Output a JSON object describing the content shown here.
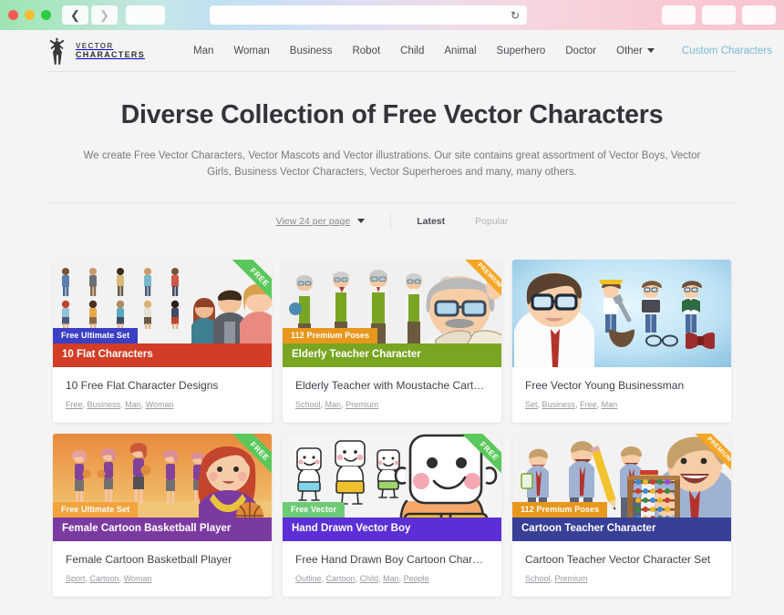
{
  "browser": {
    "back_icon": "chevron-left-icon",
    "forward_icon": "chevron-right-icon",
    "reload_icon": "reload-icon",
    "url_value": "",
    "url_placeholder": ""
  },
  "header": {
    "logo_line1": "VECTOR",
    "logo_line2": "CHARACTERS",
    "nav": [
      {
        "label": "Man"
      },
      {
        "label": "Woman"
      },
      {
        "label": "Business"
      },
      {
        "label": "Robot"
      },
      {
        "label": "Child"
      },
      {
        "label": "Animal"
      },
      {
        "label": "Superhero"
      },
      {
        "label": "Doctor"
      },
      {
        "label": "Other",
        "caret": true
      }
    ],
    "custom_link": "Custom Characters",
    "custom_link_color": "#79b9d4",
    "search_icon": "search-icon"
  },
  "hero": {
    "title": "Diverse Collection of Free Vector Characters",
    "description": "We create Free Vector Characters, Vector Mascots and Vector illustrations. Our site contains great assortment of Vector Boys, Vector Girls, Business Vector Characters, Vector Superheroes and many, many others."
  },
  "filters": {
    "per_page_label": "View 24 per page",
    "sort_latest": "Latest",
    "sort_popular": "Popular",
    "active_sort": "Latest"
  },
  "cards": [
    {
      "ribbon": "FREE",
      "ribbon_type": "free",
      "badge": "Free Ultimate Set",
      "badge_color": "#3b3fc4",
      "bar": "10 Flat Characters",
      "bar_color": "#d13d26",
      "title": "10 Free Flat Character Designs",
      "tags": [
        "Free",
        "Business",
        "Man",
        "Woman"
      ]
    },
    {
      "ribbon": "PREMIUM",
      "ribbon_type": "premium",
      "badge": "112 Premium Poses",
      "badge_color": "#e8971d",
      "bar": "Elderly Teacher Character",
      "bar_color": "#7aa522",
      "title": "Elderly Teacher with Moustache Carto…",
      "tags": [
        "School",
        "Man",
        "Premium"
      ]
    },
    {
      "ribbon": "",
      "ribbon_type": "none",
      "badge": "",
      "badge_color": "",
      "bar": "",
      "bar_color": "",
      "title": "Free Vector Young Businessman",
      "tags": [
        "Set",
        "Business",
        "Free",
        "Man"
      ]
    },
    {
      "ribbon": "FREE",
      "ribbon_type": "free",
      "badge": "Free Ultimate Set",
      "badge_color": "#f2a33c",
      "bar": "Female Cartoon Basketball Player",
      "bar_color": "#7b3aa0",
      "title": "Female Cartoon Basketball Player",
      "tags": [
        "Sport",
        "Cartoon",
        "Woman"
      ]
    },
    {
      "ribbon": "FREE",
      "ribbon_type": "free",
      "badge": "Free Vector",
      "badge_color": "#6ecb75",
      "bar": "Hand Drawn Vector Boy",
      "bar_color": "#5a2fd6",
      "title": "Free Hand Drawn Boy Cartoon Charac…",
      "tags": [
        "Outline",
        "Cartoon",
        "Child",
        "Man",
        "People"
      ]
    },
    {
      "ribbon": "PREMIUM",
      "ribbon_type": "premium",
      "badge": "112 Premium Poses",
      "badge_color": "#e8971d",
      "bar": "Cartoon Teacher Character",
      "bar_color": "#373f96",
      "title": "Cartoon Teacher Vector Character Set",
      "tags": [
        "School",
        "Premium"
      ]
    }
  ]
}
